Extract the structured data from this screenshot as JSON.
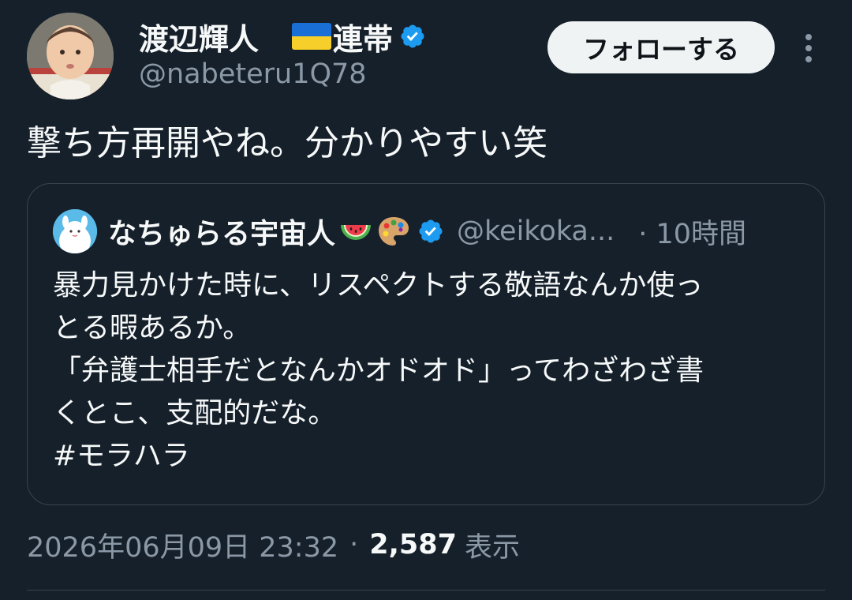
{
  "tweet": {
    "author": {
      "display_name": "渡辺輝人",
      "flag_icon": "ukraine-flag-icon",
      "name_suffix": "連帯",
      "handle": "@nabeteru1Q78",
      "verified": true
    },
    "follow_label": "フォローする",
    "text": "撃ち方再開やね。分かりやすい笑",
    "quote": {
      "display_name": "なちゅらる宇宙人",
      "emoji": [
        "watermelon-emoji",
        "palette-emoji"
      ],
      "verified": true,
      "handle": "@keikoka...",
      "time": "· 10時間",
      "lines": [
        "暴力見かけた時に、リスペクトする敬語なんか使っ",
        "とる暇あるか。",
        "「弁護士相手だとなんかオドオド」ってわざわざ書",
        "くとこ、支配的だな。",
        "#モラハラ"
      ]
    },
    "timestamp": "2026年06月09日 23:32",
    "separator": "·",
    "view_count": "2,587",
    "view_label": "表示"
  },
  "colors": {
    "background": "#15202b",
    "text_primary": "#f7f9f9",
    "text_secondary": "#8b98a5",
    "border": "#38444d",
    "verified_blue": "#1d9bf0",
    "follow_button_bg": "#eff3f4"
  }
}
